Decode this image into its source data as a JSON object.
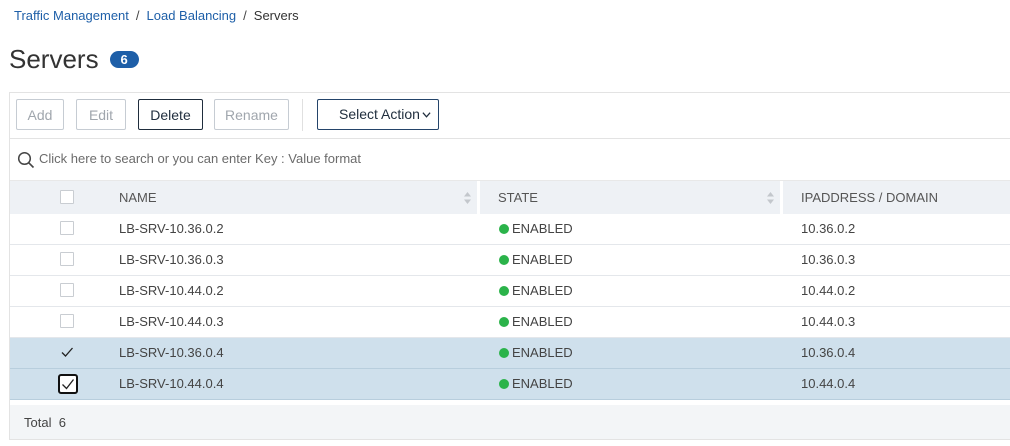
{
  "breadcrumb": {
    "items": [
      "Traffic Management",
      "Load Balancing"
    ],
    "separator": "/",
    "current": "Servers"
  },
  "page": {
    "title": "Servers",
    "count": "6"
  },
  "toolbar": {
    "add_label": "Add",
    "edit_label": "Edit",
    "delete_label": "Delete",
    "rename_label": "Rename",
    "select_action_label": "Select Action"
  },
  "search": {
    "placeholder": "Click here to search or you can enter Key : Value format"
  },
  "table": {
    "columns": [
      "NAME",
      "STATE",
      "IPADDRESS / DOMAIN"
    ],
    "rows": [
      {
        "name": "LB-SRV-10.36.0.2",
        "state": "ENABLED",
        "ip": "10.36.0.2",
        "selected": false
      },
      {
        "name": "LB-SRV-10.36.0.3",
        "state": "ENABLED",
        "ip": "10.36.0.3",
        "selected": false
      },
      {
        "name": "LB-SRV-10.44.0.2",
        "state": "ENABLED",
        "ip": "10.44.0.2",
        "selected": false
      },
      {
        "name": "LB-SRV-10.44.0.3",
        "state": "ENABLED",
        "ip": "10.44.0.3",
        "selected": false
      },
      {
        "name": "LB-SRV-10.36.0.4",
        "state": "ENABLED",
        "ip": "10.36.0.4",
        "selected": true
      },
      {
        "name": "LB-SRV-10.44.0.4",
        "state": "ENABLED",
        "ip": "10.44.0.4",
        "selected": true
      }
    ]
  },
  "footer": {
    "total_label": "Total",
    "total_value": "6"
  },
  "colors": {
    "link": "#1e5fa8",
    "badge": "#1e5fa8",
    "enabled_dot": "#2bb34a",
    "selected_row": "#cfe0ec"
  }
}
